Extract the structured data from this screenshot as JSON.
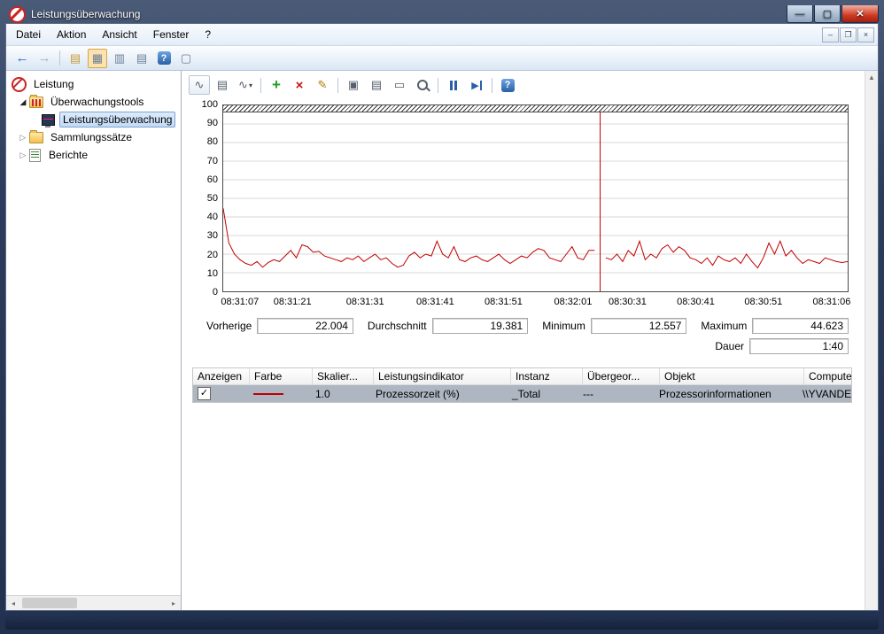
{
  "titlebar": {
    "title": "Leistungsüberwachung"
  },
  "menubar": {
    "items": [
      "Datei",
      "Aktion",
      "Ansicht",
      "Fenster",
      "?"
    ]
  },
  "icons": {
    "back": "←",
    "forward": "→",
    "export": "▤",
    "console_tree": "▦",
    "doc": "▥",
    "window": "▢",
    "help": "?",
    "minimize": "–",
    "restore": "❐",
    "close": "×",
    "chart_type": "∿",
    "view": "▤",
    "caret": "▾",
    "add": "+",
    "delete": "×",
    "highlight": "✎",
    "copy": "▣",
    "paste": "▤",
    "erase": "▭",
    "play": "▶",
    "tree_collapsed": "▷",
    "tree_expanded": "◢",
    "scroll_left": "◂",
    "scroll_right": "▸",
    "scroll_up": "▲",
    "check": "✓"
  },
  "tree": {
    "root_label": "Leistung",
    "items": [
      {
        "label": "Überwachungstools"
      },
      {
        "label": "Leistungsüberwachung",
        "selected": true
      },
      {
        "label": "Sammlungssätze"
      },
      {
        "label": "Berichte"
      }
    ]
  },
  "stats": {
    "previous_label": "Vorherige",
    "previous_value": "22.004",
    "average_label": "Durchschnitt",
    "average_value": "19.381",
    "minimum_label": "Minimum",
    "minimum_value": "12.557",
    "maximum_label": "Maximum",
    "maximum_value": "44.623",
    "duration_label": "Dauer",
    "duration_value": "1:40"
  },
  "table": {
    "headers": [
      "Anzeigen",
      "Farbe",
      "Skalier...",
      "Leistungsindikator",
      "Instanz",
      "Übergeor...",
      "Objekt",
      "Computer"
    ],
    "row": {
      "checked": true,
      "color": "#c00000",
      "scale": "1.0",
      "counter": "Prozessorzeit (%)",
      "instance": "_Total",
      "parent": "---",
      "object": "Prozessorinformationen",
      "computer": "\\\\YVANDELASERGE"
    }
  },
  "chart_data": {
    "type": "line",
    "ylim": [
      0,
      100
    ],
    "grid": "horizontal",
    "line_color": "#c00000",
    "y_ticks": [
      0,
      10,
      20,
      30,
      40,
      50,
      60,
      70,
      80,
      90,
      100
    ],
    "x_ticks": [
      {
        "label": "08:31:07",
        "pct": 2.8
      },
      {
        "label": "08:31:21",
        "pct": 11.2
      },
      {
        "label": "08:31:31",
        "pct": 22.8
      },
      {
        "label": "08:31:41",
        "pct": 34.0
      },
      {
        "label": "08:31:51",
        "pct": 44.9
      },
      {
        "label": "08:32:01",
        "pct": 56.0
      },
      {
        "label": "08:30:31",
        "pct": 64.7
      },
      {
        "label": "08:30:41",
        "pct": 75.6
      },
      {
        "label": "08:30:51",
        "pct": 86.4
      },
      {
        "label": "08:31:06",
        "pct": 97.3
      }
    ],
    "series": [
      {
        "name": "Prozessorzeit (%)",
        "color": "#c00000",
        "values": [
          44.6,
          26,
          20,
          17,
          15,
          14,
          16,
          13,
          15.5,
          17,
          16,
          19,
          22,
          18,
          25,
          24,
          21,
          21.5,
          19,
          18,
          17,
          16,
          18,
          17,
          19,
          16,
          18,
          20,
          17,
          18,
          15,
          13,
          14,
          19,
          21,
          18,
          20,
          19,
          27,
          20,
          18,
          24,
          17,
          16,
          18,
          19,
          17,
          16,
          18,
          20,
          17,
          15,
          17,
          19,
          18,
          21,
          23,
          22,
          18,
          17,
          16,
          20,
          24,
          18,
          17,
          22,
          22,
          null,
          18,
          17,
          20,
          16,
          22,
          19,
          27,
          17,
          20,
          18,
          23,
          25,
          21,
          24,
          22,
          18,
          17,
          15,
          18,
          14,
          19,
          17,
          16,
          18,
          15,
          20,
          16,
          12.6,
          18,
          26,
          20,
          27,
          19,
          22,
          18,
          15,
          17,
          16,
          15,
          18,
          17,
          16,
          15.5,
          16
        ]
      }
    ]
  }
}
